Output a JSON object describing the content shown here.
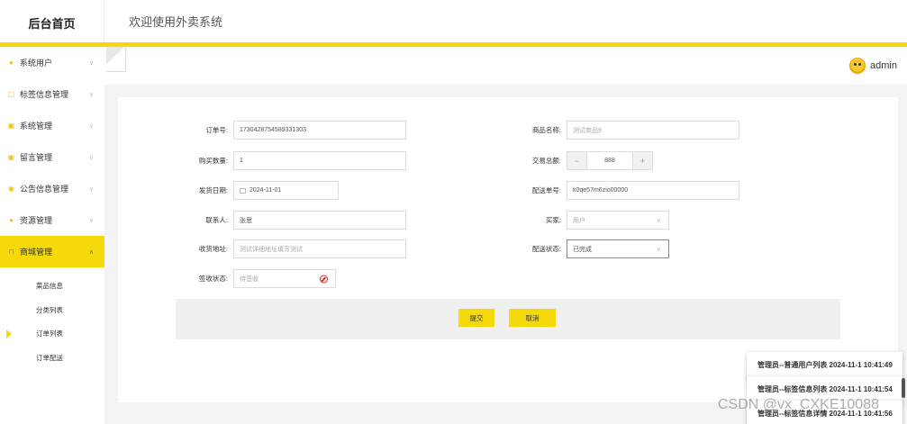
{
  "header": {
    "brand": "后台首页",
    "welcome": "欢迎使用外卖系统",
    "accent_color": "#f5d90a"
  },
  "user": {
    "name": "admin",
    "avatar_icon": "chick-avatar"
  },
  "sidebar": {
    "items": [
      {
        "label": "系统用户",
        "icon": "user-icon"
      },
      {
        "label": "标签信息管理",
        "icon": "tag-icon"
      },
      {
        "label": "系统管理",
        "icon": "settings-icon"
      },
      {
        "label": "留言管理",
        "icon": "message-icon"
      },
      {
        "label": "公告信息管理",
        "icon": "notice-icon"
      },
      {
        "label": "资源管理",
        "icon": "resource-icon"
      },
      {
        "label": "商城管理",
        "icon": "cart-icon",
        "active": true
      }
    ],
    "subitems": [
      "菜品信息",
      "分类列表",
      "订单列表",
      "订单配送"
    ],
    "current_subitem": "订单列表"
  },
  "form": {
    "order_no": {
      "label": "订单号:",
      "value": "1730428754589331303"
    },
    "product_name": {
      "label": "商品名称:",
      "placeholder": "测试商品9"
    },
    "quantity": {
      "label": "购买数量:",
      "value": "1"
    },
    "total": {
      "label": "交易总额:",
      "value": "888",
      "minus": "−",
      "plus": "+"
    },
    "ship_date": {
      "label": "发货日期:",
      "value": "2024-11-01"
    },
    "delivery_no": {
      "label": "配送单号:",
      "value": "k0qe57m6zio00000"
    },
    "contact": {
      "label": "联系人:",
      "value": "张思"
    },
    "buyer": {
      "label": "买家:",
      "placeholder": "用户"
    },
    "address": {
      "label": "收货地址:",
      "placeholder": "测试详细地址填写测试"
    },
    "delivery_status": {
      "label": "配送状态:",
      "value": "已完成"
    },
    "sign_status": {
      "label": "签收状态:",
      "placeholder": "待签收"
    }
  },
  "actions": {
    "submit": "提交",
    "cancel": "取消"
  },
  "notifications": [
    "管理员--普通用户列表 2024-11-1 10:41:49",
    "管理员--标签信息列表 2024-11-1 10:41:54",
    "管理员--标签信息详情 2024-11-1 10:41:56"
  ],
  "watermark": "CSDN @vx_CXKE10088"
}
